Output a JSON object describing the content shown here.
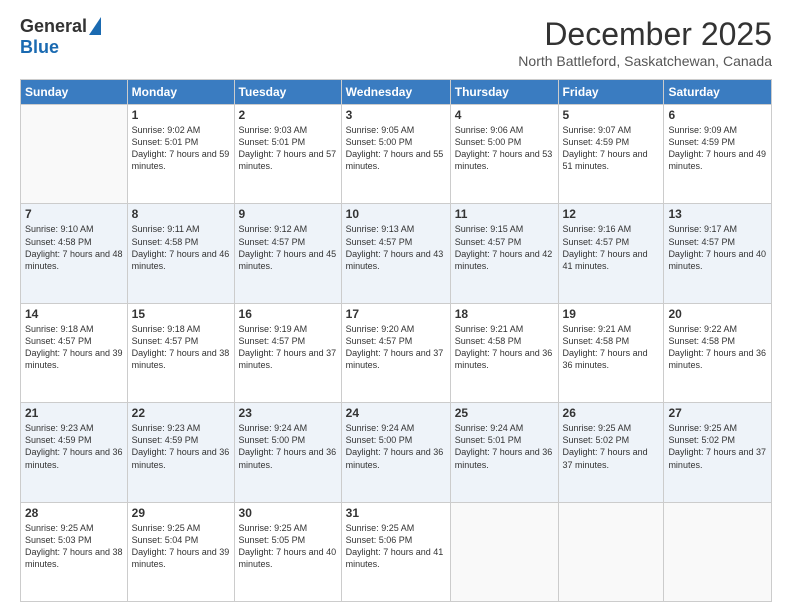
{
  "logo": {
    "general": "General",
    "blue": "Blue"
  },
  "title": "December 2025",
  "location": "North Battleford, Saskatchewan, Canada",
  "days_of_week": [
    "Sunday",
    "Monday",
    "Tuesday",
    "Wednesday",
    "Thursday",
    "Friday",
    "Saturday"
  ],
  "weeks": [
    [
      {
        "day": "",
        "sunrise": "",
        "sunset": "",
        "daylight": ""
      },
      {
        "day": "1",
        "sunrise": "Sunrise: 9:02 AM",
        "sunset": "Sunset: 5:01 PM",
        "daylight": "Daylight: 7 hours and 59 minutes."
      },
      {
        "day": "2",
        "sunrise": "Sunrise: 9:03 AM",
        "sunset": "Sunset: 5:01 PM",
        "daylight": "Daylight: 7 hours and 57 minutes."
      },
      {
        "day": "3",
        "sunrise": "Sunrise: 9:05 AM",
        "sunset": "Sunset: 5:00 PM",
        "daylight": "Daylight: 7 hours and 55 minutes."
      },
      {
        "day": "4",
        "sunrise": "Sunrise: 9:06 AM",
        "sunset": "Sunset: 5:00 PM",
        "daylight": "Daylight: 7 hours and 53 minutes."
      },
      {
        "day": "5",
        "sunrise": "Sunrise: 9:07 AM",
        "sunset": "Sunset: 4:59 PM",
        "daylight": "Daylight: 7 hours and 51 minutes."
      },
      {
        "day": "6",
        "sunrise": "Sunrise: 9:09 AM",
        "sunset": "Sunset: 4:59 PM",
        "daylight": "Daylight: 7 hours and 49 minutes."
      }
    ],
    [
      {
        "day": "7",
        "sunrise": "Sunrise: 9:10 AM",
        "sunset": "Sunset: 4:58 PM",
        "daylight": "Daylight: 7 hours and 48 minutes."
      },
      {
        "day": "8",
        "sunrise": "Sunrise: 9:11 AM",
        "sunset": "Sunset: 4:58 PM",
        "daylight": "Daylight: 7 hours and 46 minutes."
      },
      {
        "day": "9",
        "sunrise": "Sunrise: 9:12 AM",
        "sunset": "Sunset: 4:57 PM",
        "daylight": "Daylight: 7 hours and 45 minutes."
      },
      {
        "day": "10",
        "sunrise": "Sunrise: 9:13 AM",
        "sunset": "Sunset: 4:57 PM",
        "daylight": "Daylight: 7 hours and 43 minutes."
      },
      {
        "day": "11",
        "sunrise": "Sunrise: 9:15 AM",
        "sunset": "Sunset: 4:57 PM",
        "daylight": "Daylight: 7 hours and 42 minutes."
      },
      {
        "day": "12",
        "sunrise": "Sunrise: 9:16 AM",
        "sunset": "Sunset: 4:57 PM",
        "daylight": "Daylight: 7 hours and 41 minutes."
      },
      {
        "day": "13",
        "sunrise": "Sunrise: 9:17 AM",
        "sunset": "Sunset: 4:57 PM",
        "daylight": "Daylight: 7 hours and 40 minutes."
      }
    ],
    [
      {
        "day": "14",
        "sunrise": "Sunrise: 9:18 AM",
        "sunset": "Sunset: 4:57 PM",
        "daylight": "Daylight: 7 hours and 39 minutes."
      },
      {
        "day": "15",
        "sunrise": "Sunrise: 9:18 AM",
        "sunset": "Sunset: 4:57 PM",
        "daylight": "Daylight: 7 hours and 38 minutes."
      },
      {
        "day": "16",
        "sunrise": "Sunrise: 9:19 AM",
        "sunset": "Sunset: 4:57 PM",
        "daylight": "Daylight: 7 hours and 37 minutes."
      },
      {
        "day": "17",
        "sunrise": "Sunrise: 9:20 AM",
        "sunset": "Sunset: 4:57 PM",
        "daylight": "Daylight: 7 hours and 37 minutes."
      },
      {
        "day": "18",
        "sunrise": "Sunrise: 9:21 AM",
        "sunset": "Sunset: 4:58 PM",
        "daylight": "Daylight: 7 hours and 36 minutes."
      },
      {
        "day": "19",
        "sunrise": "Sunrise: 9:21 AM",
        "sunset": "Sunset: 4:58 PM",
        "daylight": "Daylight: 7 hours and 36 minutes."
      },
      {
        "day": "20",
        "sunrise": "Sunrise: 9:22 AM",
        "sunset": "Sunset: 4:58 PM",
        "daylight": "Daylight: 7 hours and 36 minutes."
      }
    ],
    [
      {
        "day": "21",
        "sunrise": "Sunrise: 9:23 AM",
        "sunset": "Sunset: 4:59 PM",
        "daylight": "Daylight: 7 hours and 36 minutes."
      },
      {
        "day": "22",
        "sunrise": "Sunrise: 9:23 AM",
        "sunset": "Sunset: 4:59 PM",
        "daylight": "Daylight: 7 hours and 36 minutes."
      },
      {
        "day": "23",
        "sunrise": "Sunrise: 9:24 AM",
        "sunset": "Sunset: 5:00 PM",
        "daylight": "Daylight: 7 hours and 36 minutes."
      },
      {
        "day": "24",
        "sunrise": "Sunrise: 9:24 AM",
        "sunset": "Sunset: 5:00 PM",
        "daylight": "Daylight: 7 hours and 36 minutes."
      },
      {
        "day": "25",
        "sunrise": "Sunrise: 9:24 AM",
        "sunset": "Sunset: 5:01 PM",
        "daylight": "Daylight: 7 hours and 36 minutes."
      },
      {
        "day": "26",
        "sunrise": "Sunrise: 9:25 AM",
        "sunset": "Sunset: 5:02 PM",
        "daylight": "Daylight: 7 hours and 37 minutes."
      },
      {
        "day": "27",
        "sunrise": "Sunrise: 9:25 AM",
        "sunset": "Sunset: 5:02 PM",
        "daylight": "Daylight: 7 hours and 37 minutes."
      }
    ],
    [
      {
        "day": "28",
        "sunrise": "Sunrise: 9:25 AM",
        "sunset": "Sunset: 5:03 PM",
        "daylight": "Daylight: 7 hours and 38 minutes."
      },
      {
        "day": "29",
        "sunrise": "Sunrise: 9:25 AM",
        "sunset": "Sunset: 5:04 PM",
        "daylight": "Daylight: 7 hours and 39 minutes."
      },
      {
        "day": "30",
        "sunrise": "Sunrise: 9:25 AM",
        "sunset": "Sunset: 5:05 PM",
        "daylight": "Daylight: 7 hours and 40 minutes."
      },
      {
        "day": "31",
        "sunrise": "Sunrise: 9:25 AM",
        "sunset": "Sunset: 5:06 PM",
        "daylight": "Daylight: 7 hours and 41 minutes."
      },
      {
        "day": "",
        "sunrise": "",
        "sunset": "",
        "daylight": ""
      },
      {
        "day": "",
        "sunrise": "",
        "sunset": "",
        "daylight": ""
      },
      {
        "day": "",
        "sunrise": "",
        "sunset": "",
        "daylight": ""
      }
    ]
  ]
}
